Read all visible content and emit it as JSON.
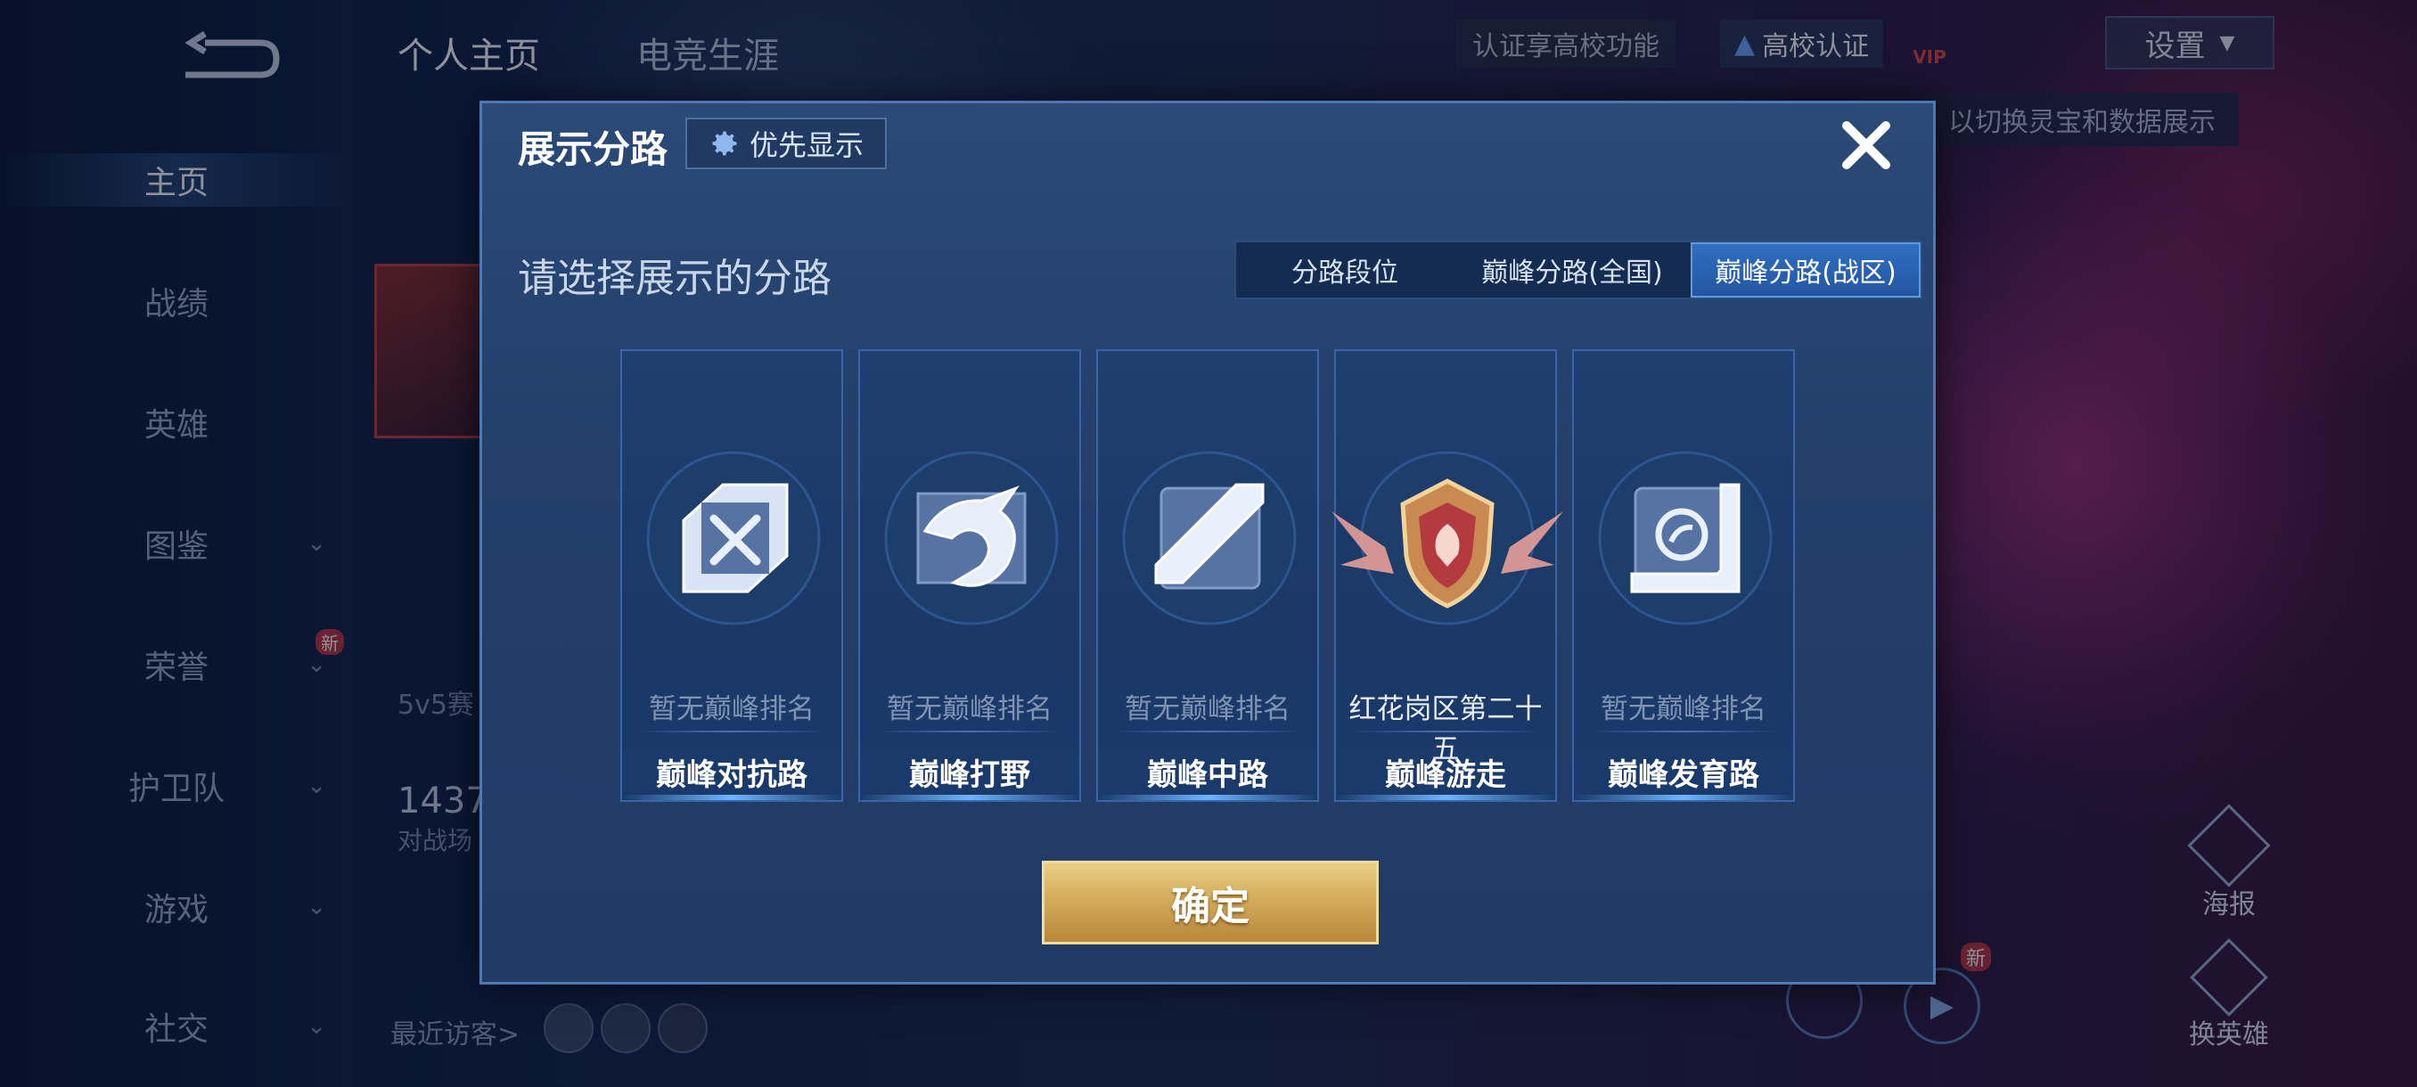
{
  "left_nav": {
    "items": [
      {
        "label": "主页",
        "active": true,
        "chevron": false
      },
      {
        "label": "战绩",
        "active": false,
        "chevron": false
      },
      {
        "label": "英雄",
        "active": false,
        "chevron": false
      },
      {
        "label": "图鉴",
        "active": false,
        "chevron": true
      },
      {
        "label": "荣誉",
        "active": false,
        "chevron": true
      },
      {
        "label": "护卫队",
        "active": false,
        "chevron": true
      },
      {
        "label": "游戏",
        "active": false,
        "chevron": true
      },
      {
        "label": "社交",
        "active": false,
        "chevron": true
      }
    ],
    "honor_badge": "新"
  },
  "top_tabs": [
    "个人主页",
    "电竞生涯"
  ],
  "top_right": {
    "campus_hint": "认证享高校功能",
    "campus_button": "高校认证",
    "vip_label": "VIP",
    "settings": "设置",
    "tooltip": "以切换灵宝和数据展示"
  },
  "profile_bits": {
    "mode_label": "5v5赛",
    "count": "1437",
    "count_label": "对战场",
    "recent_visitors": "最近访客>"
  },
  "right_actions": {
    "poster": "海报",
    "switch_hero": "换英雄",
    "new_badge": "新"
  },
  "dialog": {
    "title": "展示分路",
    "priority_button": "优先显示",
    "prompt": "请选择展示的分路",
    "tabs": [
      {
        "label": "分路段位",
        "active": false
      },
      {
        "label": "巅峰分路(全国)",
        "active": false
      },
      {
        "label": "巅峰分路(战区)",
        "active": true
      }
    ],
    "cards": [
      {
        "rank": "暂无巅峰排名",
        "lane": "巅峰对抗路",
        "icon": "clash-lane-icon"
      },
      {
        "rank": "暂无巅峰排名",
        "lane": "巅峰打野",
        "icon": "jungle-dragon-icon"
      },
      {
        "rank": "暂无巅峰排名",
        "lane": "巅峰中路",
        "icon": "mid-lane-icon"
      },
      {
        "rank": "红花岗区第二十五",
        "lane": "巅峰游走",
        "icon": "roam-crest-icon"
      },
      {
        "rank": "暂无巅峰排名",
        "lane": "巅峰发育路",
        "icon": "farm-lane-icon"
      }
    ],
    "confirm": "确定"
  },
  "colors": {
    "dialog_bg": "#233f6a",
    "active_tab": "#2f6fc0",
    "confirm_gold": "#d3ab5b",
    "accent_pink": "#eb3c96"
  }
}
